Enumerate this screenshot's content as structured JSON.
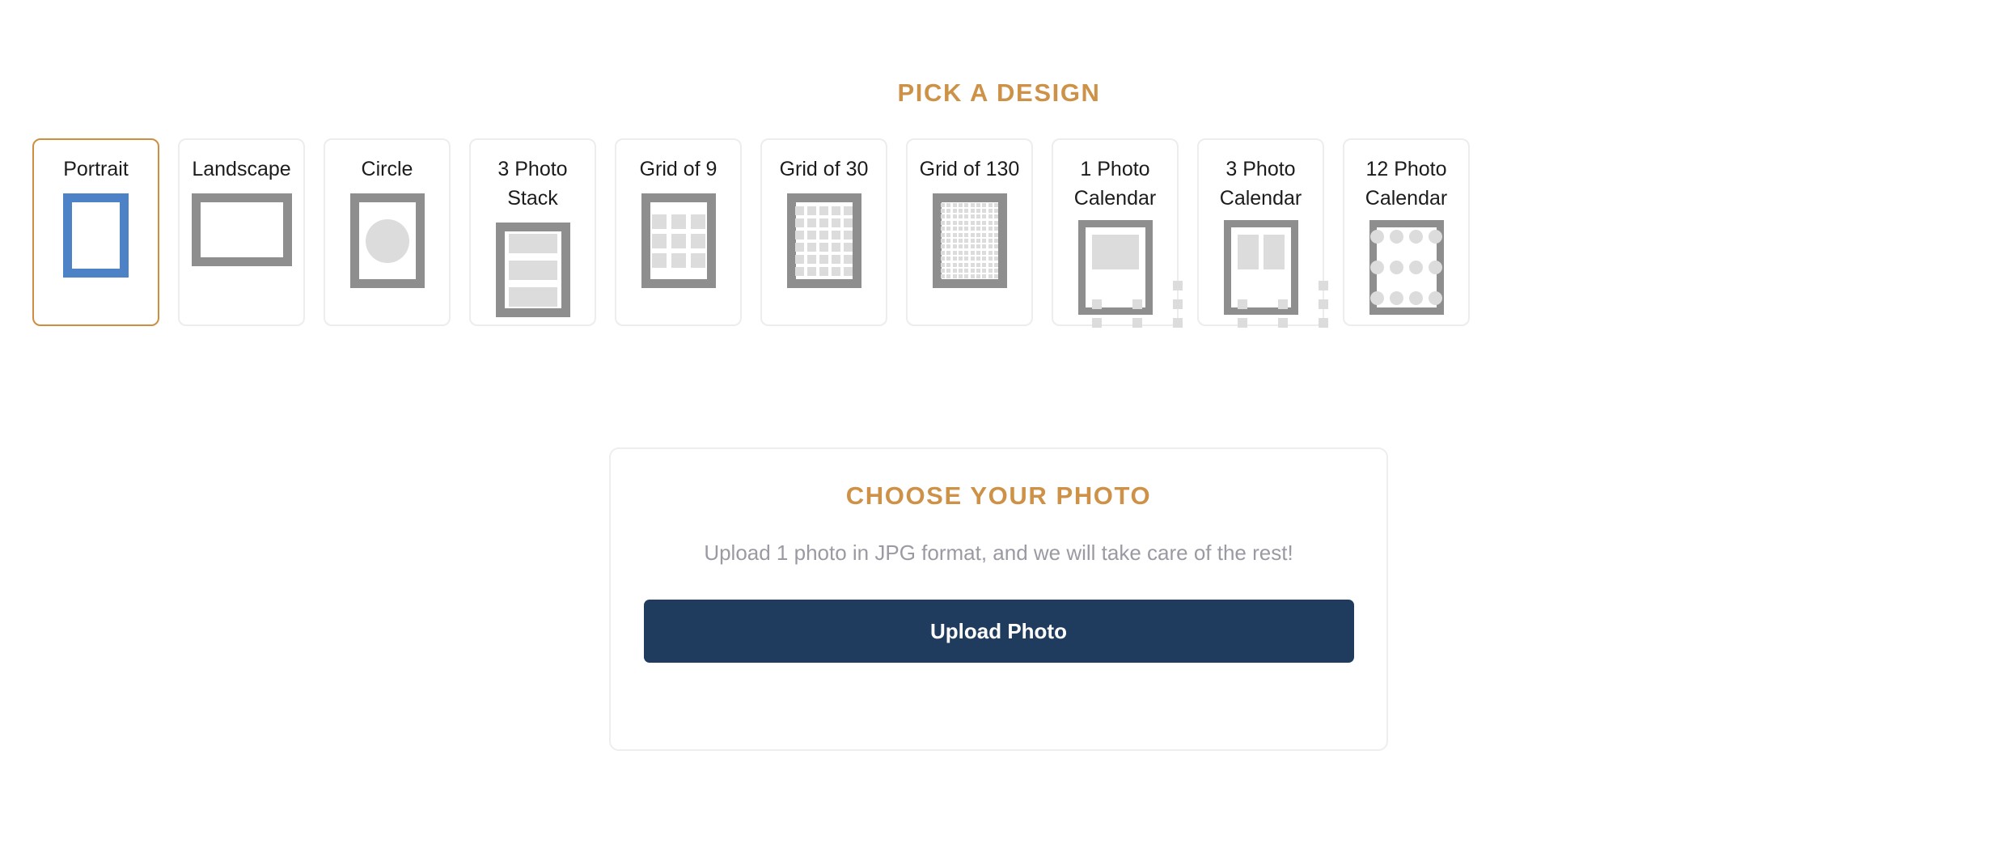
{
  "design_section": {
    "title": "PICK A DESIGN",
    "accent_color": "#cd9248",
    "selected_border_color": "#cd8f3f",
    "card_border_color": "#ededee",
    "thumb_frame_color": "#8e8e8e",
    "thumb_selected_frame_color": "#4d82c7",
    "thumb_fill_color": "#dcdcdc",
    "cards": [
      {
        "label": "Portrait",
        "thumb": "portrait-frame",
        "selected": true
      },
      {
        "label": "Landscape",
        "thumb": "landscape-frame",
        "selected": false
      },
      {
        "label": "Circle",
        "thumb": "circle-frame",
        "selected": false
      },
      {
        "label": "3 Photo Stack",
        "thumb": "stack-3-frame",
        "selected": false
      },
      {
        "label": "Grid of 9",
        "thumb": "grid-9-frame",
        "selected": false
      },
      {
        "label": "Grid of 30",
        "thumb": "grid-30-frame",
        "selected": false
      },
      {
        "label": "Grid of 130",
        "thumb": "grid-130-frame",
        "selected": false
      },
      {
        "label": "1 Photo\nCalendar",
        "thumb": "calendar-1-frame",
        "selected": false
      },
      {
        "label": "3 Photo\nCalendar",
        "thumb": "calendar-3-frame",
        "selected": false
      },
      {
        "label": "12 Photo\nCalendar",
        "thumb": "calendar-12-frame",
        "selected": false
      }
    ]
  },
  "choose_photo": {
    "title": "CHOOSE YOUR PHOTO",
    "description": "Upload 1 photo in JPG format, and we will take care of the rest!",
    "button_label": "Upload Photo",
    "button_color": "#1f3c5e",
    "description_color": "#9a9aa3"
  }
}
